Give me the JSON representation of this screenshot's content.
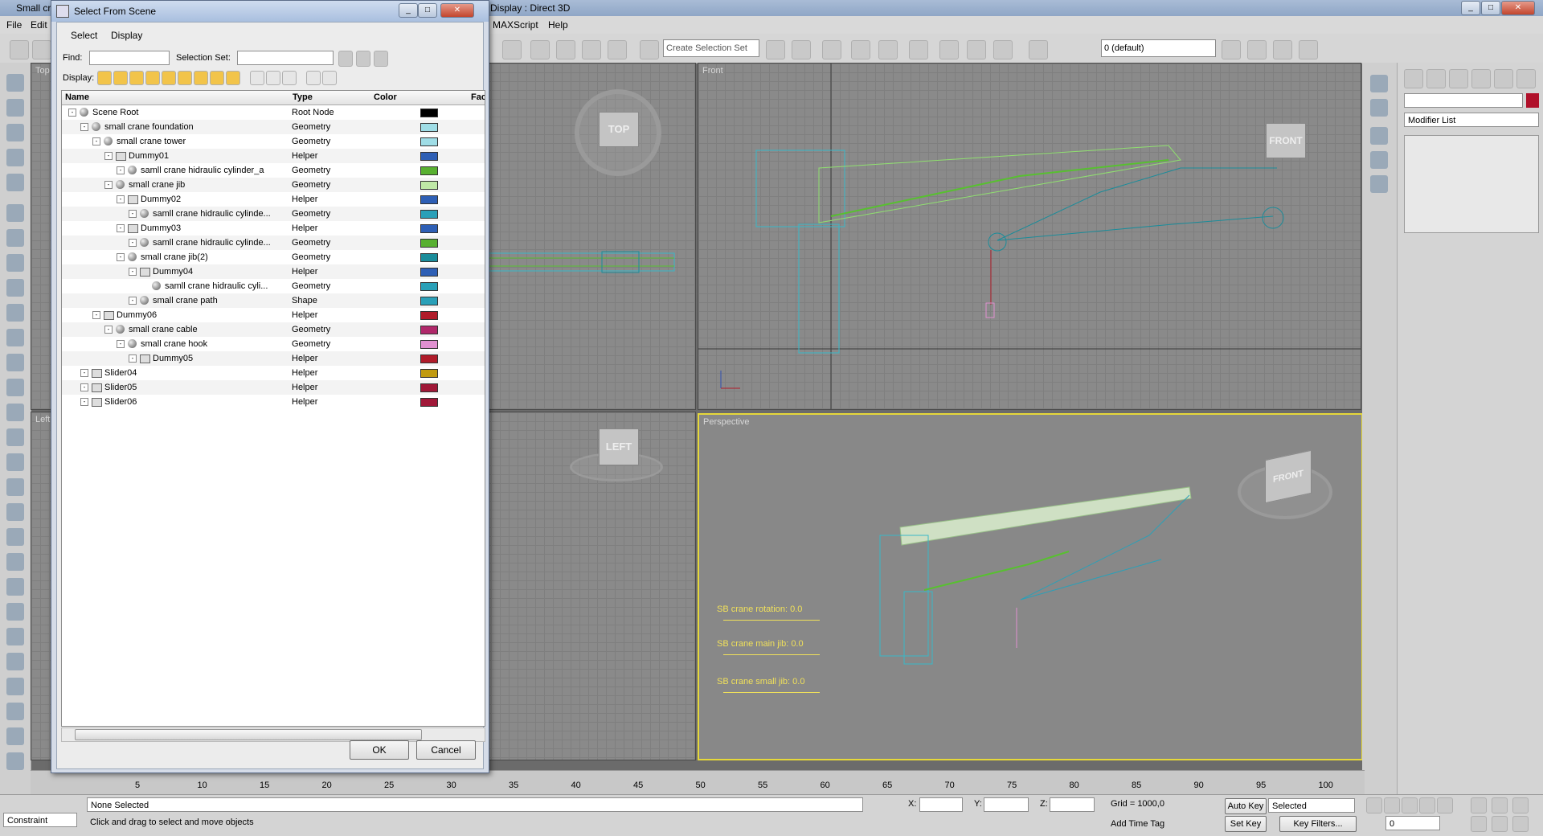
{
  "app": {
    "title_left": "Small cr",
    "title_right": "Display : Direct 3D",
    "menu": [
      "File",
      "Edit"
    ],
    "menu_right": [
      "MAXScript",
      "Help"
    ]
  },
  "toolbar": {
    "selection_set_placeholder": "Create Selection Set",
    "layer_name": "0 (default)"
  },
  "viewports": {
    "top": "Top",
    "front": "Front",
    "left": "Left",
    "perspective": "Perspective",
    "cube_top": "TOP",
    "cube_front": "FRONT",
    "cube_left": "LEFT",
    "persp_cube_front": "FRONT"
  },
  "sliders": [
    {
      "label": "SB crane rotation: 0.0"
    },
    {
      "label": "SB crane  main jib: 0.0"
    },
    {
      "label": "SB crane small jib: 0.0"
    }
  ],
  "command_panel": {
    "modifier_list": "Modifier List"
  },
  "dialog": {
    "title": "Select From Scene",
    "menu_select": "Select",
    "menu_display": "Display",
    "find_label": "Find:",
    "find_value": "",
    "selection_set_label": "Selection Set:",
    "display_label": "Display:",
    "columns": {
      "name": "Name",
      "type": "Type",
      "color": "Color",
      "faces": "Fac"
    },
    "ok": "OK",
    "cancel": "Cancel",
    "rows": [
      {
        "name": "Scene Root",
        "type": "Root Node",
        "color": "#000000",
        "indent": 0,
        "icon": "root"
      },
      {
        "name": "small crane foundation",
        "type": "Geometry",
        "color": "#9fdde6",
        "indent": 1,
        "icon": "geo"
      },
      {
        "name": "small crane tower",
        "type": "Geometry",
        "color": "#9fdde6",
        "indent": 2,
        "icon": "geo"
      },
      {
        "name": "Dummy01",
        "type": "Helper",
        "color": "#2e5fb5",
        "indent": 3,
        "icon": "helper"
      },
      {
        "name": "samll crane hidraulic cylinder_a",
        "type": "Geometry",
        "color": "#58b030",
        "indent": 4,
        "icon": "geo"
      },
      {
        "name": "small crane jib",
        "type": "Geometry",
        "color": "#bfe8a6",
        "indent": 3,
        "icon": "geo"
      },
      {
        "name": "Dummy02",
        "type": "Helper",
        "color": "#2e5fb5",
        "indent": 4,
        "icon": "helper"
      },
      {
        "name": "samll crane hidraulic cylinde...",
        "type": "Geometry",
        "color": "#2aa0b8",
        "indent": 5,
        "icon": "geo"
      },
      {
        "name": "Dummy03",
        "type": "Helper",
        "color": "#2e5fb5",
        "indent": 4,
        "icon": "helper"
      },
      {
        "name": "samll crane hidraulic cylinde...",
        "type": "Geometry",
        "color": "#58b030",
        "indent": 5,
        "icon": "geo"
      },
      {
        "name": "small crane jib(2)",
        "type": "Geometry",
        "color": "#1a8c9a",
        "indent": 4,
        "icon": "geo"
      },
      {
        "name": "Dummy04",
        "type": "Helper",
        "color": "#2e5fb5",
        "indent": 5,
        "icon": "helper"
      },
      {
        "name": "samll crane hidraulic cyli...",
        "type": "Geometry",
        "color": "#2aa0b8",
        "indent": 6,
        "icon": "geo"
      },
      {
        "name": "small crane path",
        "type": "Shape",
        "color": "#2aa0b8",
        "indent": 5,
        "icon": "shape"
      },
      {
        "name": "Dummy06",
        "type": "Helper",
        "color": "#b01c2a",
        "indent": 2,
        "icon": "helper"
      },
      {
        "name": "small crane cable",
        "type": "Geometry",
        "color": "#b0286a",
        "indent": 3,
        "icon": "geo"
      },
      {
        "name": "small crane hook",
        "type": "Geometry",
        "color": "#e090d0",
        "indent": 4,
        "icon": "geo"
      },
      {
        "name": "Dummy05",
        "type": "Helper",
        "color": "#b01c2a",
        "indent": 5,
        "icon": "helper"
      },
      {
        "name": "Slider04",
        "type": "Helper",
        "color": "#c09a10",
        "indent": 1,
        "icon": "helper"
      },
      {
        "name": "Slider05",
        "type": "Helper",
        "color": "#a01838",
        "indent": 1,
        "icon": "helper"
      },
      {
        "name": "Slider06",
        "type": "Helper",
        "color": "#a01838",
        "indent": 1,
        "icon": "helper"
      }
    ]
  },
  "timeline": {
    "ticks": [
      "5",
      "10",
      "15",
      "20",
      "25",
      "30",
      "35",
      "40",
      "45",
      "50",
      "55",
      "60",
      "65",
      "70",
      "75",
      "80",
      "85",
      "90",
      "95",
      "100"
    ]
  },
  "status": {
    "selection": "None Selected",
    "prompt": "Click and drag to select and move objects",
    "constraint": "Constraint",
    "x_label": "X:",
    "y_label": "Y:",
    "z_label": "Z:",
    "grid": "Grid = 1000,0",
    "add_time_tag": "Add Time Tag",
    "auto_key": "Auto Key",
    "set_key": "Set Key",
    "selected": "Selected",
    "key_filters": "Key Filters...",
    "frame": "0"
  }
}
